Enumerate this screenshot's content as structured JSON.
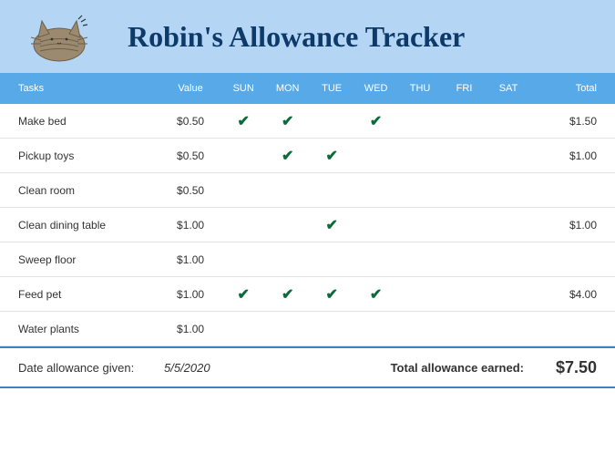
{
  "header": {
    "title": "Robin's Allowance Tracker"
  },
  "columns": {
    "tasks": "Tasks",
    "value": "Value",
    "days": [
      "SUN",
      "MON",
      "TUE",
      "WED",
      "THU",
      "FRI",
      "SAT"
    ],
    "total": "Total"
  },
  "rows": [
    {
      "task": "Make bed",
      "value": "$0.50",
      "checks": [
        true,
        true,
        false,
        true,
        false,
        false,
        false
      ],
      "total": "$1.50"
    },
    {
      "task": "Pickup toys",
      "value": "$0.50",
      "checks": [
        false,
        true,
        true,
        false,
        false,
        false,
        false
      ],
      "total": "$1.00"
    },
    {
      "task": "Clean room",
      "value": "$0.50",
      "checks": [
        false,
        false,
        false,
        false,
        false,
        false,
        false
      ],
      "total": ""
    },
    {
      "task": "Clean dining table",
      "value": "$1.00",
      "checks": [
        false,
        false,
        true,
        false,
        false,
        false,
        false
      ],
      "total": "$1.00"
    },
    {
      "task": "Sweep floor",
      "value": "$1.00",
      "checks": [
        false,
        false,
        false,
        false,
        false,
        false,
        false
      ],
      "total": ""
    },
    {
      "task": "Feed pet",
      "value": "$1.00",
      "checks": [
        true,
        true,
        true,
        true,
        false,
        false,
        false
      ],
      "total": "$4.00"
    },
    {
      "task": "Water plants",
      "value": "$1.00",
      "checks": [
        false,
        false,
        false,
        false,
        false,
        false,
        false
      ],
      "total": ""
    }
  ],
  "footer": {
    "dateLabel": "Date allowance given:",
    "date": "5/5/2020",
    "totalLabel": "Total allowance earned:",
    "total": "$7.50"
  },
  "chart_data": {
    "type": "table",
    "title": "Robin's Allowance Tracker",
    "columns": [
      "Task",
      "Value",
      "SUN",
      "MON",
      "TUE",
      "WED",
      "THU",
      "FRI",
      "SAT",
      "Total"
    ],
    "rows": [
      [
        "Make bed",
        0.5,
        1,
        1,
        0,
        1,
        0,
        0,
        0,
        1.5
      ],
      [
        "Pickup toys",
        0.5,
        0,
        1,
        1,
        0,
        0,
        0,
        0,
        1.0
      ],
      [
        "Clean room",
        0.5,
        0,
        0,
        0,
        0,
        0,
        0,
        0,
        null
      ],
      [
        "Clean dining table",
        1.0,
        0,
        0,
        1,
        0,
        0,
        0,
        0,
        1.0
      ],
      [
        "Sweep floor",
        1.0,
        0,
        0,
        0,
        0,
        0,
        0,
        0,
        null
      ],
      [
        "Feed pet",
        1.0,
        1,
        1,
        1,
        1,
        0,
        0,
        0,
        4.0
      ],
      [
        "Water plants",
        1.0,
        0,
        0,
        0,
        0,
        0,
        0,
        0,
        null
      ]
    ],
    "total_earned": 7.5,
    "date_given": "5/5/2020"
  }
}
